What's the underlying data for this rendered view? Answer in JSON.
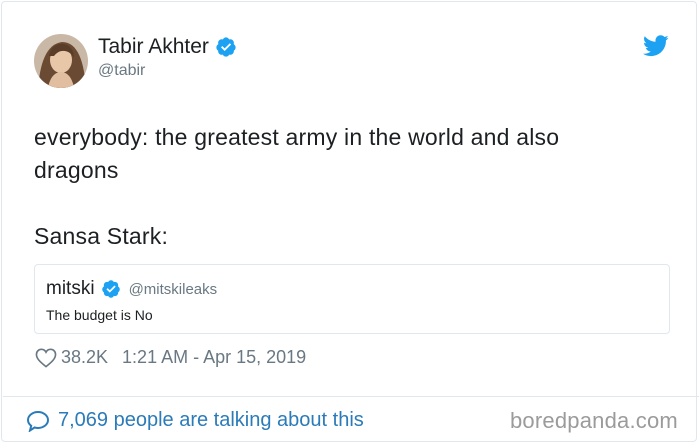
{
  "author": {
    "name": "Tabir Akhter",
    "handle": "@tabir"
  },
  "icons": {
    "verified": "verified-badge-icon",
    "brand": "twitter-bird-icon",
    "like": "heart-icon",
    "conversation": "speech-bubble-icon"
  },
  "colors": {
    "verified_blue": "#1da1f2",
    "link_blue": "#2b7bb9",
    "muted": "#697882",
    "border": "#e1e8ed"
  },
  "tweet": {
    "line1": "everybody: the greatest army in the world and also",
    "line2": "dragons",
    "line3": "Sansa Stark:"
  },
  "quoted": {
    "name": "mitski",
    "handle": "@mitskileaks",
    "text": "The budget is No"
  },
  "meta": {
    "likes": "38.2K",
    "timestamp": "1:21 AM - Apr 15, 2019"
  },
  "footer": {
    "talking": "7,069 people are talking about this",
    "watermark": "boredpanda.com"
  }
}
